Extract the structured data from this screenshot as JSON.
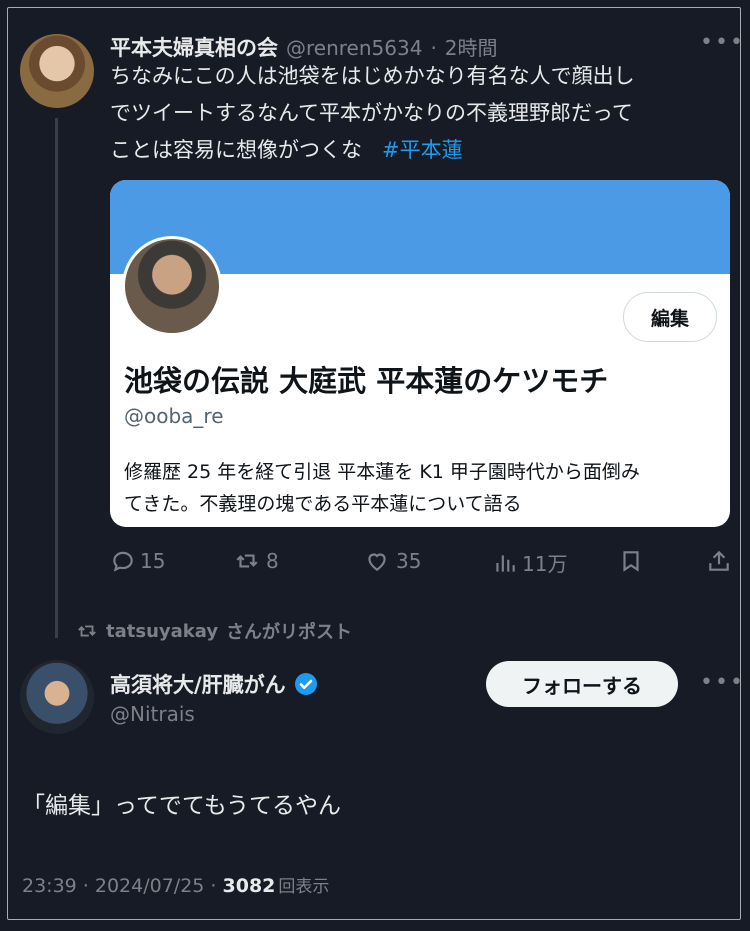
{
  "tweet1": {
    "author_name": "平本夫婦真相の会",
    "handle": "@renren5634",
    "separator": "·",
    "time": "2時間",
    "text_lines": [
      "ちなみにこの人は池袋をはじめかなり有名な人で顔出し",
      "でツイートするなんて平本がかなりの不義理野郎だって",
      "ことは容易に想像がつくな"
    ],
    "hashtag": "#平本蓮",
    "more_icon": "more-horizontal-icon"
  },
  "card": {
    "edit_label": "編集",
    "title": "池袋の伝説 大庭武 平本蓮のケツモチ",
    "handle": "@ooba_re",
    "bio_lines": [
      "修羅歴 25 年を経て引退 平本蓮を K1 甲子園時代から面倒み",
      "てきた。不義理の塊である平本蓮について語る"
    ],
    "banner_color": "#4a9ae6"
  },
  "actions": {
    "replies": "15",
    "reposts": "8",
    "likes": "35",
    "views": "11万"
  },
  "repost_banner": {
    "user": "tatsuyakay",
    "text": "さんがリポスト"
  },
  "tweet2": {
    "author_name": "高須将大/肝臓がん",
    "verified": true,
    "handle": "@Nitrais",
    "follow_label": "フォローする",
    "text": "「編集」ってでてもうてるやん",
    "timestamp": "23:39 · 2024/07/25 · ",
    "view_count": "3082",
    "view_label": "回表示"
  },
  "colors": {
    "background": "#161b25",
    "accent": "#1d9bf0",
    "muted": "#7b8189"
  }
}
